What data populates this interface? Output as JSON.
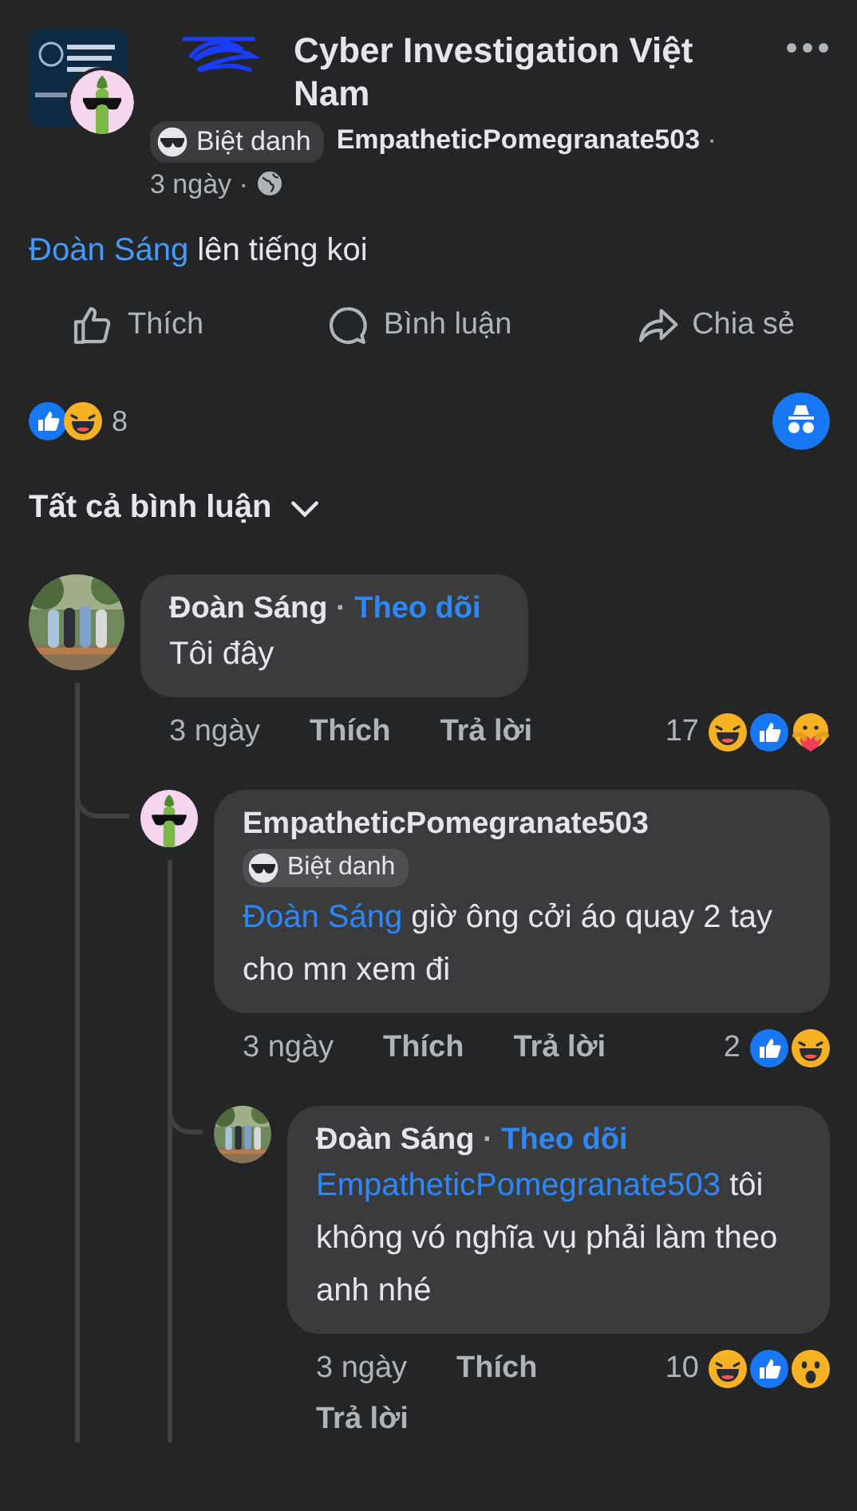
{
  "post": {
    "group_name": "Cyber Investigation Việt Nam",
    "redacted": true,
    "author_badge": "Biệt danh",
    "author": "EmpatheticPomegranate503",
    "separator": "·",
    "time": "3 ngày"
  },
  "post_body": {
    "mention": "Đoàn Sáng",
    "text": "lên tiếng koi"
  },
  "actions": [
    {
      "kind": "like",
      "label": "Thích"
    },
    {
      "kind": "comment",
      "label": "Bình luận"
    },
    {
      "kind": "share",
      "label": "Chia sẻ"
    }
  ],
  "reactions": {
    "icons": [
      {
        "kind": "like"
      },
      {
        "kind": "haha"
      }
    ],
    "count": "8"
  },
  "comment_filter": "Tất cả bình luận",
  "comments": [
    {
      "author": "Đoàn Sáng",
      "avatar": {
        "kind": "picture"
      },
      "separator": "·",
      "follow": "Theo dõi",
      "text": "Tôi đây",
      "time": "3 ngày",
      "like": "Thích",
      "reply": "Trả lời",
      "reaction_count": "17",
      "reactions": [
        {
          "kind": "haha"
        },
        {
          "kind": "like"
        },
        {
          "kind": "care"
        }
      ],
      "children": [
        {
          "author": "EmpatheticPomegranate503",
          "avatar": {
            "kind": "cartoon"
          },
          "badge": "Biệt danh",
          "mention": "Đoàn Sáng",
          "text": "giờ ông cởi áo quay 2 tay cho mn xem đi",
          "time": "3 ngày",
          "like": "Thích",
          "reply": "Trả lời",
          "reaction_count": "2",
          "reactions": [
            {
              "kind": "like"
            },
            {
              "kind": "haha"
            }
          ],
          "children": [
            {
              "author": "Đoàn Sáng",
              "avatar": {
                "kind": "picture"
              },
              "separator": "·",
              "follow": "Theo dõi",
              "mention": "EmpatheticPomegranate503",
              "text": "tôi không vó nghĩa vụ phải làm theo anh nhé",
              "time": "3 ngày",
              "like": "Thích",
              "reply": "Trả lời",
              "reaction_count": "10",
              "reactions": [
                {
                  "kind": "haha"
                },
                {
                  "kind": "like"
                },
                {
                  "kind": "wow"
                }
              ]
            }
          ]
        }
      ]
    }
  ]
}
